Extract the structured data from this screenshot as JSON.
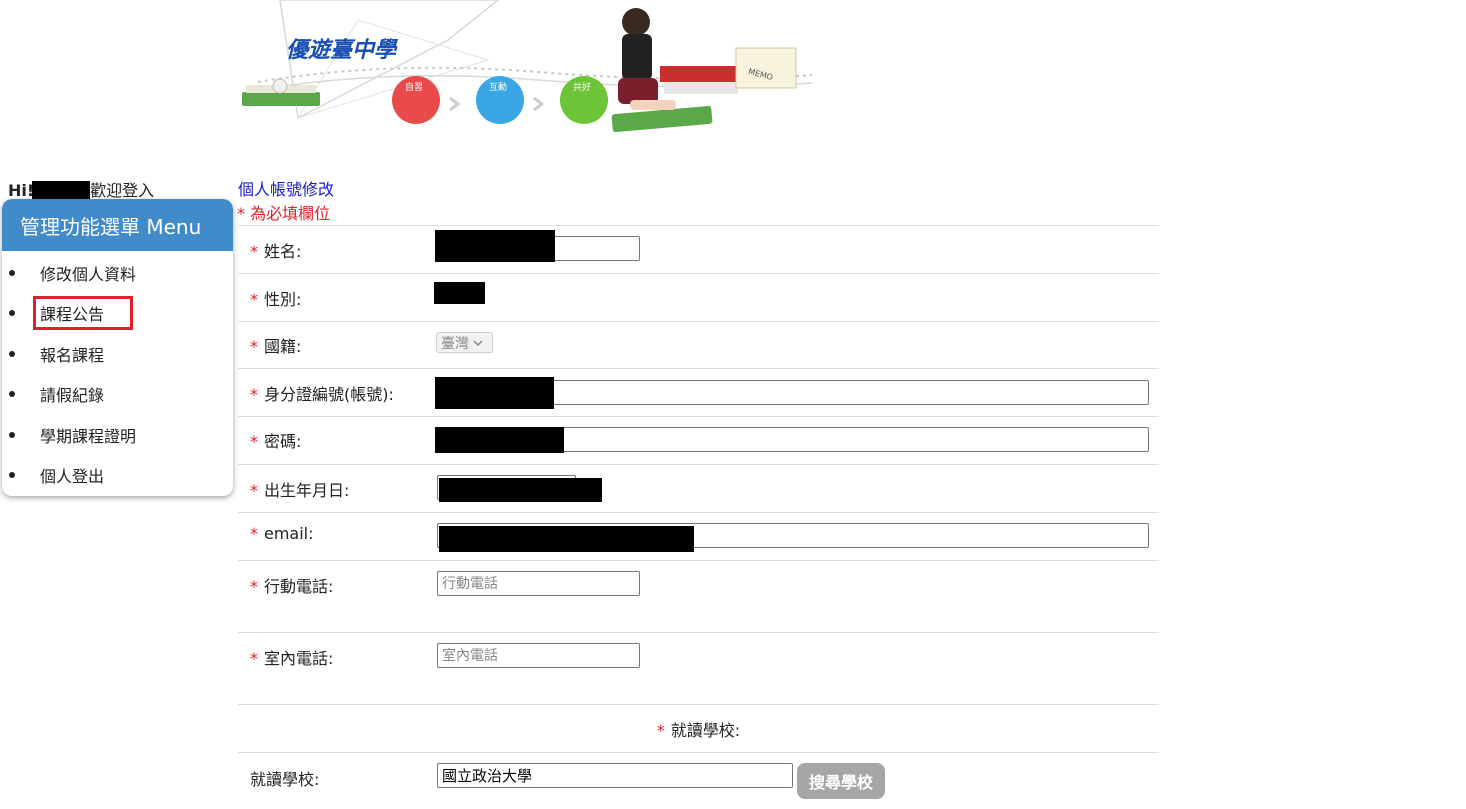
{
  "banner": {
    "title": "優遊臺中學",
    "steps": [
      "自習",
      "互動",
      "共好"
    ],
    "memo": "MEMO"
  },
  "user": {
    "hi": "Hi!",
    "welcome": "歡迎登入"
  },
  "menu": {
    "title": "管理功能選單 Menu",
    "items": [
      {
        "label": "修改個人資料"
      },
      {
        "label": "課程公告"
      },
      {
        "label": "報名課程"
      },
      {
        "label": "請假紀錄"
      },
      {
        "label": "學期課程證明"
      },
      {
        "label": "個人登出"
      }
    ]
  },
  "form": {
    "title": "個人帳號修改",
    "required_note": "* 為必填欄位",
    "star": "*",
    "fields": {
      "name": {
        "label": "姓名:"
      },
      "gender": {
        "label": "性別:"
      },
      "nationality": {
        "label": "國籍:",
        "value": "臺灣"
      },
      "id_number": {
        "label": "身分證編號(帳號):"
      },
      "password": {
        "label": "密碼:"
      },
      "birthday": {
        "label": "出生年月日:"
      },
      "email": {
        "label": "email:"
      },
      "mobile": {
        "label": "行動電話:",
        "placeholder": "行動電話"
      },
      "home_phone": {
        "label": "室內電話:",
        "placeholder": "室內電話"
      },
      "school_header": {
        "label": "就讀學校:"
      },
      "school": {
        "label": "就讀學校:",
        "value": "國立政治大學",
        "search_button": "搜尋學校"
      }
    }
  },
  "colors": {
    "menu_header": "#428bca",
    "required": "#e0202a",
    "title_link": "#1a1ad0",
    "highlight": "#e0202a"
  }
}
